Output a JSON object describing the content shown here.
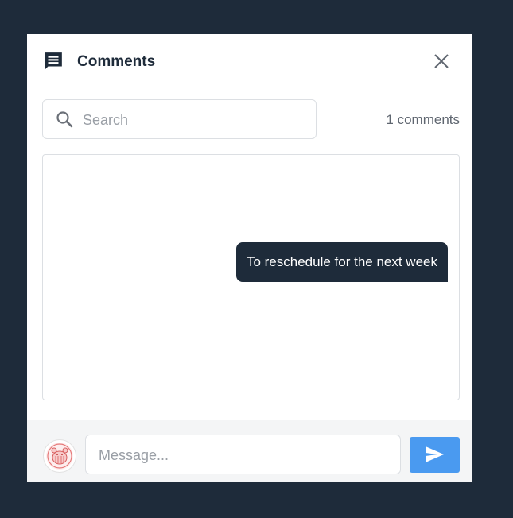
{
  "header": {
    "title": "Comments",
    "icon": "comment-icon",
    "close_icon": "close-icon"
  },
  "search": {
    "placeholder": "Search",
    "icon": "search-icon"
  },
  "comment_count": "1 comments",
  "comments": [
    {
      "text": "To reschedule for the next week"
    }
  ],
  "composer": {
    "placeholder": "Message...",
    "send_icon": "send-icon"
  },
  "colors": {
    "background": "#1e2b3a",
    "bubble": "#1e2b3a",
    "send_button": "#4a9af0",
    "footer": "#f4f5f6"
  }
}
